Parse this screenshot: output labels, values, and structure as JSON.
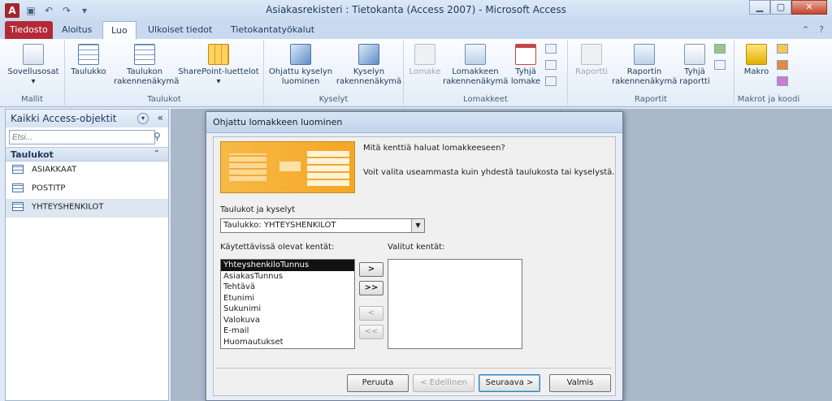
{
  "window": {
    "app_icon": "A",
    "title": "Asiakasrekisteri : Tietokanta (Access 2007)  -  Microsoft Access",
    "qat_icons": [
      "save-icon",
      "undo-icon",
      "redo-icon",
      "customize-icon"
    ]
  },
  "tabs": [
    {
      "label": "Tiedosto"
    },
    {
      "label": "Aloitus"
    },
    {
      "label": "Luo"
    },
    {
      "label": "Ulkoiset tiedot"
    },
    {
      "label": "Tietokantatyökalut"
    }
  ],
  "ribbon": {
    "groups": {
      "mallit": "Mallit",
      "taulukot": "Taulukot",
      "kyselyt": "Kyselyt",
      "lomakkeet": "Lomakkeet",
      "raportit": "Raportit",
      "makrot": "Makrot ja koodi"
    },
    "buttons": {
      "sovellusosat": "Sovellusosat",
      "taulukko": "Taulukko",
      "taulukon_rak": [
        "Taulukon",
        "rakennenäkymä"
      ],
      "sharepoint": "SharePoint-luettelot",
      "ohjattu_kysely": [
        "Ohjattu kyselyn",
        "luominen"
      ],
      "kyselyn_rak": [
        "Kyselyn",
        "rakennenäkymä"
      ],
      "lomake": "Lomake",
      "lomakkeen_rak": [
        "Lomakkeen",
        "rakennenäkymä"
      ],
      "tyhja_lomake": [
        "Tyhjä",
        "lomake"
      ],
      "raportti": "Raportti",
      "raportin_rak": [
        "Raportin",
        "rakennenäkymä"
      ],
      "tyhja_raportti": [
        "Tyhjä",
        "raportti"
      ],
      "makro": "Makro"
    }
  },
  "nav": {
    "header": "Kaikki Access-objektit",
    "search_placeholder": "Etsi...",
    "group": "Taulukot",
    "items": [
      "ASIAKKAAT",
      "POSTITP",
      "YHTEYSHENKILOT"
    ]
  },
  "dialog": {
    "title": "Ohjattu lomakkeen luominen",
    "question": "Mitä kenttiä haluat lomakkeeseen?",
    "hint": "Voit valita useammasta kuin yhdestä taulukosta tai kyselystä.",
    "tables_label": "Taulukot ja kyselyt",
    "tables_value": "Taulukko: YHTEYSHENKILOT",
    "available_label": "Käytettävissä olevat kentät:",
    "selected_label": "Valitut kentät:",
    "available_fields": [
      "YhteyshenkiloTunnus",
      "AsiakasTunnus",
      "Tehtävä",
      "Etunimi",
      "Sukunimi",
      "Valokuva",
      "E-mail",
      "Huomautukset"
    ],
    "move_buttons": [
      ">",
      ">>",
      "<",
      "<<"
    ],
    "buttons": {
      "cancel": "Peruuta",
      "back": "< Edellinen",
      "next": "Seuraava >",
      "finish": "Valmis"
    }
  }
}
